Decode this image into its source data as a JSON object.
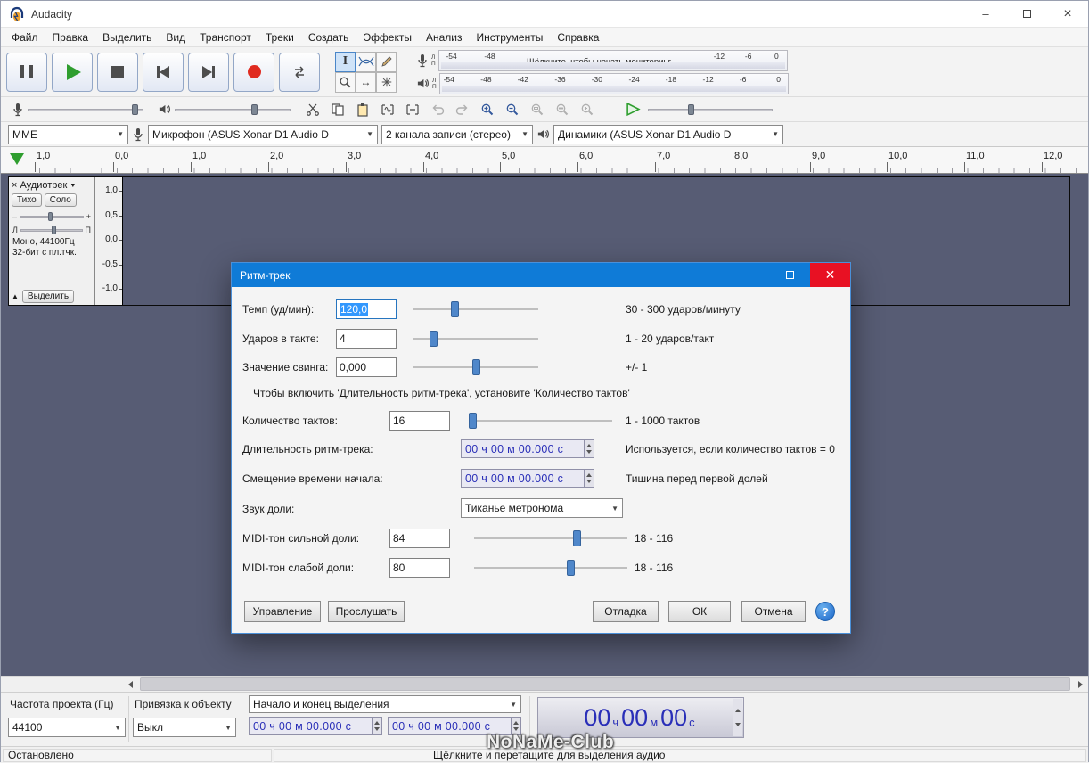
{
  "colors": {
    "accent": "#0f7bd7",
    "close_red": "#e81123",
    "slate": "#575c74",
    "record_red": "#e02b20",
    "time_blue": "#2a2fb8",
    "selection_blue": "#3297fd"
  },
  "window": {
    "title": "Audacity",
    "minimize": "–",
    "close": "×"
  },
  "menu": {
    "items": [
      "Файл",
      "Правка",
      "Выделить",
      "Вид",
      "Транспорт",
      "Треки",
      "Создать",
      "Эффекты",
      "Анализ",
      "Инструменты",
      "Справка"
    ]
  },
  "meters": {
    "ch_left": "Л",
    "ch_right": "П",
    "record_ticks": [
      "-54",
      "-48",
      "-12",
      "-6",
      "0"
    ],
    "record_message": "Щёлкните, чтобы начать мониторинг",
    "play_ticks": [
      "-54",
      "-48",
      "-42",
      "-36",
      "-30",
      "-24",
      "-18",
      "-12",
      "-6",
      "0"
    ]
  },
  "mixer": {
    "mic_level": "90%",
    "output_level": "66%"
  },
  "play_speed": {
    "pos": "32%"
  },
  "device": {
    "host": "MME",
    "input": "Микрофон (ASUS Xonar D1 Audio D",
    "channels": "2 канала записи (стерео)",
    "output": "Динамики (ASUS Xonar D1 Audio D"
  },
  "timeline": {
    "labels": [
      "1,0",
      "0,0",
      "1,0",
      "2,0",
      "3,0",
      "4,0",
      "5,0",
      "6,0",
      "7,0",
      "8,0",
      "9,0",
      "10,0",
      "11,0",
      "12,0"
    ]
  },
  "track": {
    "close": "×",
    "name": "Аудиотрек",
    "menu_arrow": "▼",
    "mute": "Тихо",
    "solo": "Соло",
    "gain_min": "–",
    "gain_max": "+",
    "gain_pos": "45%",
    "pan_left": "Л",
    "pan_right": "П",
    "pan_pos": "50%",
    "info_line1": "Моно, 44100Гц",
    "info_line2": "32-бит с пл.тчк.",
    "collapse": "▲",
    "select_button": "Выделить",
    "scale": [
      "1,0",
      "0,5",
      "0,0",
      "-0,5",
      "-1,0"
    ]
  },
  "dialog": {
    "title": "Ритм-трек",
    "note": "Чтобы включить 'Длительность ритм-трека', установите 'Количество тактов'",
    "rows": [
      {
        "label": "Темп (уд/мин):",
        "value": "120,0",
        "slider": "33%",
        "hint": "30 - 300 ударов/минуту"
      },
      {
        "label": "Ударов в такте:",
        "value": "4",
        "slider": "16%",
        "hint": "1 - 20 ударов/такт"
      },
      {
        "label": "Значение свинга:",
        "value": "0,000",
        "slider": "50%",
        "hint": "+/- 1"
      },
      {
        "label": "Количество тактов:",
        "value": "16",
        "slider": "2%",
        "hint": "1 - 1000 тактов"
      },
      {
        "label": "Длительность ритм-трека:",
        "value": "00 ч 00 м 00.000 с",
        "hint": "Используется, если количество тактов = 0"
      },
      {
        "label": "Смещение времени начала:",
        "value": "00 ч 00 м 00.000 с",
        "hint": "Тишина перед первой долей"
      },
      {
        "label": "Звук доли:",
        "value": "Тиканье метронома"
      },
      {
        "label": "MIDI-тон сильной доли:",
        "value": "84",
        "slider": "67%",
        "hint": "18 - 116"
      },
      {
        "label": "MIDI-тон слабой доли:",
        "value": "80",
        "slider": "63%",
        "hint": "18 - 116"
      }
    ],
    "buttons": {
      "manage": "Управление",
      "preview": "Прослушать",
      "debug": "Отладка",
      "ok": "ОК",
      "cancel": "Отмена",
      "help": "?"
    }
  },
  "selection_bar": {
    "rate_label": "Частота проекта (Гц)",
    "rate_value": "44100",
    "snap_label": "Привязка к объекту",
    "snap_value": "Выкл",
    "mode_value": "Начало и конец выделения",
    "sel_start": "00 ч 00 м 00.000 с",
    "sel_end": "00 ч 00 м 00.000 с",
    "big_time": {
      "h": "00",
      "h_unit": "ч",
      "m": "00",
      "m_unit": "м",
      "s": "00",
      "s_unit": "с"
    }
  },
  "status": {
    "state": "Остановлено",
    "message": "Щёлкните и перетащите для выделения аудио"
  },
  "watermark": "NoNaMe-Club"
}
